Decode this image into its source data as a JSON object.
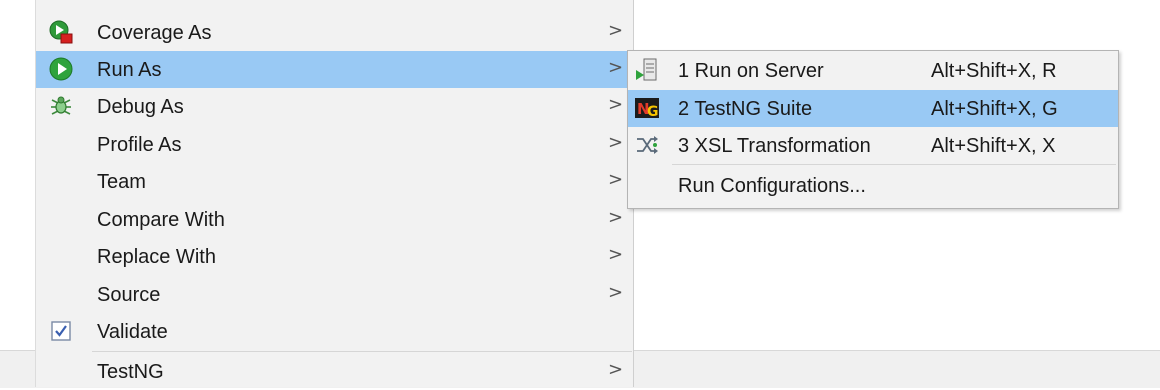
{
  "context_menu": {
    "items": [
      {
        "label": "Coverage As",
        "icon": "coverage-icon",
        "has_submenu": true
      },
      {
        "label": "Run As",
        "icon": "run-icon",
        "has_submenu": true,
        "highlighted": true
      },
      {
        "label": "Debug As",
        "icon": "debug-bug-icon",
        "has_submenu": true
      },
      {
        "label": "Profile As",
        "icon": "",
        "has_submenu": true
      },
      {
        "label": "Team",
        "icon": "",
        "has_submenu": true
      },
      {
        "label": "Compare With",
        "icon": "",
        "has_submenu": true
      },
      {
        "label": "Replace With",
        "icon": "",
        "has_submenu": true
      },
      {
        "label": "Source",
        "icon": "",
        "has_submenu": true
      },
      {
        "label": "Validate",
        "icon": "validate-checkbox-icon",
        "has_submenu": false
      },
      {
        "label": "TestNG",
        "icon": "",
        "has_submenu": true
      }
    ],
    "arrow_glyph": ">"
  },
  "run_as_submenu": {
    "items": [
      {
        "label": "1 Run on Server",
        "shortcut": "Alt+Shift+X, R",
        "icon": "server-icon"
      },
      {
        "label": "2 TestNG Suite",
        "shortcut": "Alt+Shift+X, G",
        "icon": "testng-icon",
        "highlighted": true
      },
      {
        "label": "3 XSL Transformation",
        "shortcut": "Alt+Shift+X, X",
        "icon": "xsl-transform-icon"
      },
      {
        "label": "Run Configurations...",
        "shortcut": "",
        "icon": ""
      }
    ]
  },
  "colors": {
    "highlight": "#99c9f4",
    "menu_background": "#f2f2f2"
  }
}
